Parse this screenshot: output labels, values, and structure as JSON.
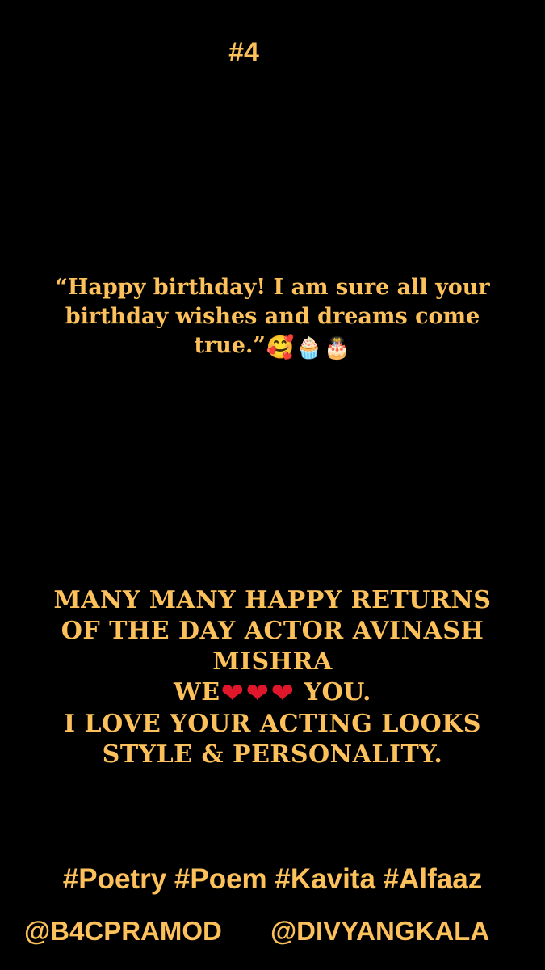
{
  "post": {
    "number": "#4",
    "quote": "“Happy birthday! I am sure all your birthday wishes and dreams come true.”",
    "quote_emojis": {
      "hug": "🥰",
      "cupcake": "🧁",
      "cake": "🎂"
    },
    "wish_lines": [
      "MANY MANY HAPPY RETURNS",
      "OF THE DAY ACTOR AVINASH",
      "MISHRA"
    ],
    "we_text": "WE",
    "heart": "❤",
    "you_text": "YOU.",
    "love_lines": [
      "I LOVE YOUR ACTING LOOKS",
      "STYLE & PERSONALITY."
    ],
    "hashtags": "#Poetry #Poem #Kavita #Alfaaz",
    "handles": [
      "@B4CPRAMOD",
      "@DIVYANGKALA"
    ]
  },
  "colors": {
    "background": "#000000",
    "text": "#fcc15b",
    "heart": "#e0162b"
  },
  "icons": [
    "smiling-face-with-hearts-icon",
    "cupcake-icon",
    "birthday-cake-icon",
    "red-heart-icon"
  ]
}
